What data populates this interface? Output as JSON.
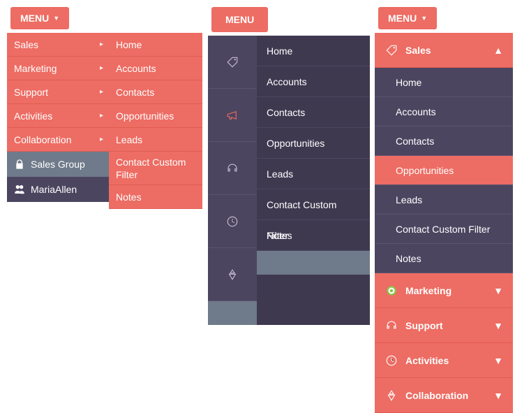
{
  "menu_label": "MENU",
  "panel1": {
    "categories": [
      {
        "label": "Sales"
      },
      {
        "label": "Marketing"
      },
      {
        "label": "Support"
      },
      {
        "label": "Activities"
      },
      {
        "label": "Collaboration"
      }
    ],
    "submenu": [
      {
        "label": "Home"
      },
      {
        "label": "Accounts"
      },
      {
        "label": "Contacts"
      },
      {
        "label": "Opportunities"
      },
      {
        "label": "Leads"
      },
      {
        "label": "Contact Custom Filter"
      },
      {
        "label": "Notes"
      }
    ],
    "extra": [
      {
        "icon": "lock-icon",
        "label": "Sales Group"
      },
      {
        "icon": "users-icon",
        "label": "MariaAllen"
      }
    ]
  },
  "panel2": {
    "icons": [
      {
        "name": "tag-icon",
        "active": false
      },
      {
        "name": "megaphone-icon",
        "active": true
      },
      {
        "name": "headset-icon",
        "active": false
      },
      {
        "name": "clock-icon",
        "active": false
      },
      {
        "name": "collab-icon",
        "active": false
      }
    ],
    "submenu": [
      {
        "label": "Home"
      },
      {
        "label": "Accounts"
      },
      {
        "label": "Contacts"
      },
      {
        "label": "Opportunities"
      },
      {
        "label": "Leads"
      },
      {
        "label": "Contact Custom Filter"
      },
      {
        "label": "Notes"
      }
    ]
  },
  "panel3": {
    "sections": [
      {
        "icon": "tag-icon",
        "label": "Sales",
        "expanded": true,
        "items": [
          {
            "label": "Home",
            "selected": false
          },
          {
            "label": "Accounts",
            "selected": false
          },
          {
            "label": "Contacts",
            "selected": false
          },
          {
            "label": "Opportunities",
            "selected": true
          },
          {
            "label": "Leads",
            "selected": false
          },
          {
            "label": "Contact Custom Filter",
            "selected": false
          },
          {
            "label": "Notes",
            "selected": false
          }
        ]
      },
      {
        "icon": "target-icon",
        "label": "Marketing",
        "expanded": false
      },
      {
        "icon": "headset-icon",
        "label": "Support",
        "expanded": false
      },
      {
        "icon": "clock-icon",
        "label": "Activities",
        "expanded": false
      },
      {
        "icon": "collab-icon",
        "label": "Collaboration",
        "expanded": false
      }
    ]
  }
}
